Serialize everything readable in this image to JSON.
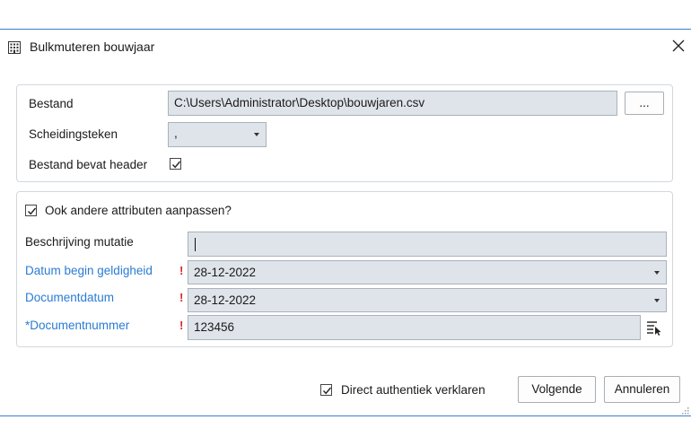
{
  "window": {
    "title": "Bulkmuteren bouwjaar"
  },
  "file_panel": {
    "bestand_label": "Bestand",
    "bestand_value": "C:\\Users\\Administrator\\Desktop\\bouwjaren.csv",
    "browse_label": "...",
    "scheidingsteken_label": "Scheidingsteken",
    "scheidingsteken_value": ",",
    "header_label": "Bestand bevat header",
    "header_checked": true
  },
  "attr_panel": {
    "andere_label": "Ook andere attributen aanpassen?",
    "andere_checked": true,
    "beschrijving_label": "Beschrijving mutatie",
    "beschrijving_value": "",
    "datum_label": "Datum begin geldigheid",
    "datum_value": "28-12-2022",
    "documentdatum_label": "Documentdatum",
    "documentdatum_value": "28-12-2022",
    "documentnummer_label": "*Documentnummer",
    "documentnummer_value": "123456",
    "required_mark": "!"
  },
  "footer": {
    "authentiek_label": "Direct authentiek verklaren",
    "authentiek_checked": true,
    "volgende_label": "Volgende",
    "annuleren_label": "Annuleren"
  },
  "colors": {
    "accent_line": "#3c7fd1",
    "link_label": "#2a7bd3",
    "required": "#d9262a",
    "field_bg": "#dfe4ea"
  },
  "icons": {
    "title": "building-icon",
    "close": "close-icon",
    "picker": "list-pick-icon"
  }
}
